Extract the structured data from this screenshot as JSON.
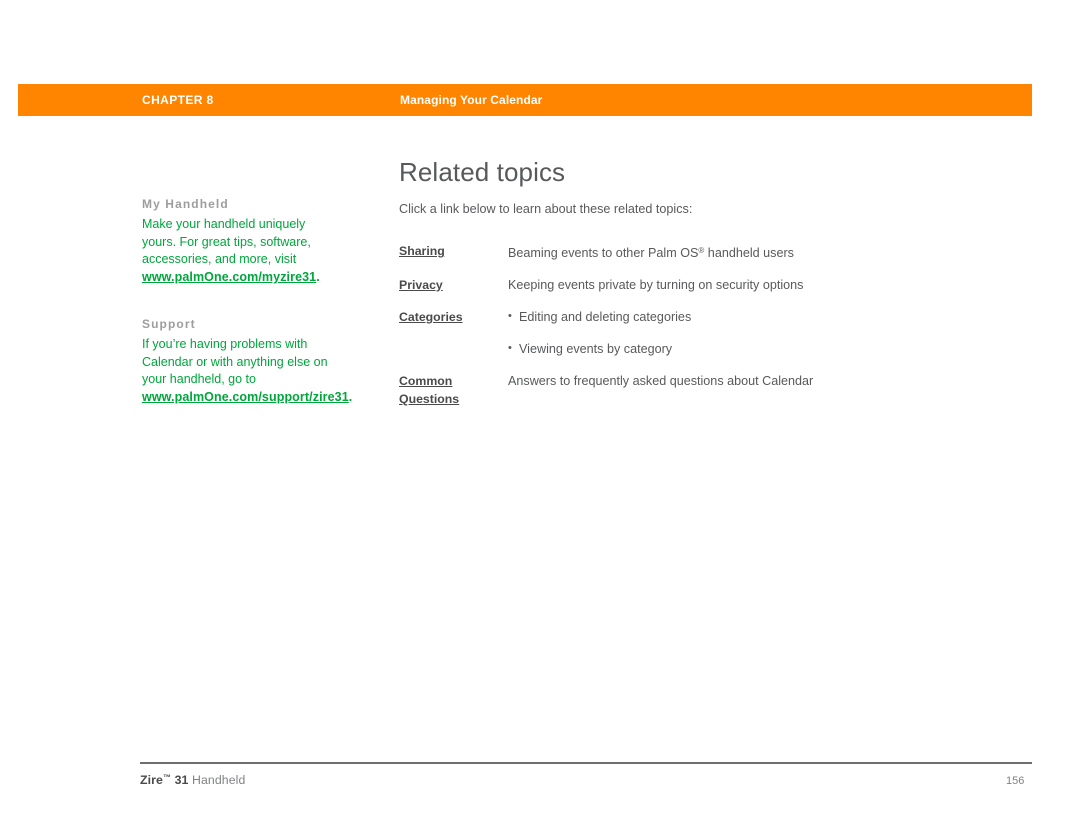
{
  "header": {
    "chapter_label": "CHAPTER 8",
    "section_title": "Managing Your Calendar",
    "bar_color": "#ff8400"
  },
  "sidebar": {
    "blocks": [
      {
        "heading": "My Handheld",
        "body": "Make your handheld uniquely yours. For great tips, software, accessories, and more, visit ",
        "link_line1": "www.palmOne.com/",
        "link_line2": "myzire31",
        "trailing": ".",
        "link_color": "#00a63c"
      },
      {
        "heading": "Support",
        "body": "If you’re having problems with Calendar or with anything else on your handheld, go to ",
        "link_line1": "www.palmOne.com/",
        "link_line2": "support/zire31",
        "trailing": ".",
        "link_color": "#00a63c"
      }
    ]
  },
  "main": {
    "title": "Related topics",
    "intro": "Click a link below to learn about these related topics:",
    "rows": [
      {
        "link": "Sharing",
        "desc_before": "Beaming events to other Palm OS",
        "desc_reg": "®",
        "desc_after": " handheld users",
        "bullet": false
      },
      {
        "link": "Privacy",
        "desc_before": "Keeping events private by turning on security options",
        "desc_reg": "",
        "desc_after": "",
        "bullet": false
      },
      {
        "link": "Categories",
        "desc_before": "Editing and deleting categories",
        "desc_reg": "",
        "desc_after": "",
        "bullet": true
      },
      {
        "link": "",
        "desc_before": "Viewing events by category",
        "desc_reg": "",
        "desc_after": "",
        "bullet": true
      },
      {
        "link_line1": "Common ",
        "link_line2": "Questions",
        "desc_before": "Answers to frequently asked questions about Calendar",
        "desc_reg": "",
        "desc_after": "",
        "bullet": false
      }
    ]
  },
  "footer": {
    "brand": "Zire",
    "tm": "™",
    "model": " 31",
    "product": " Handheld",
    "page_number": "156"
  }
}
